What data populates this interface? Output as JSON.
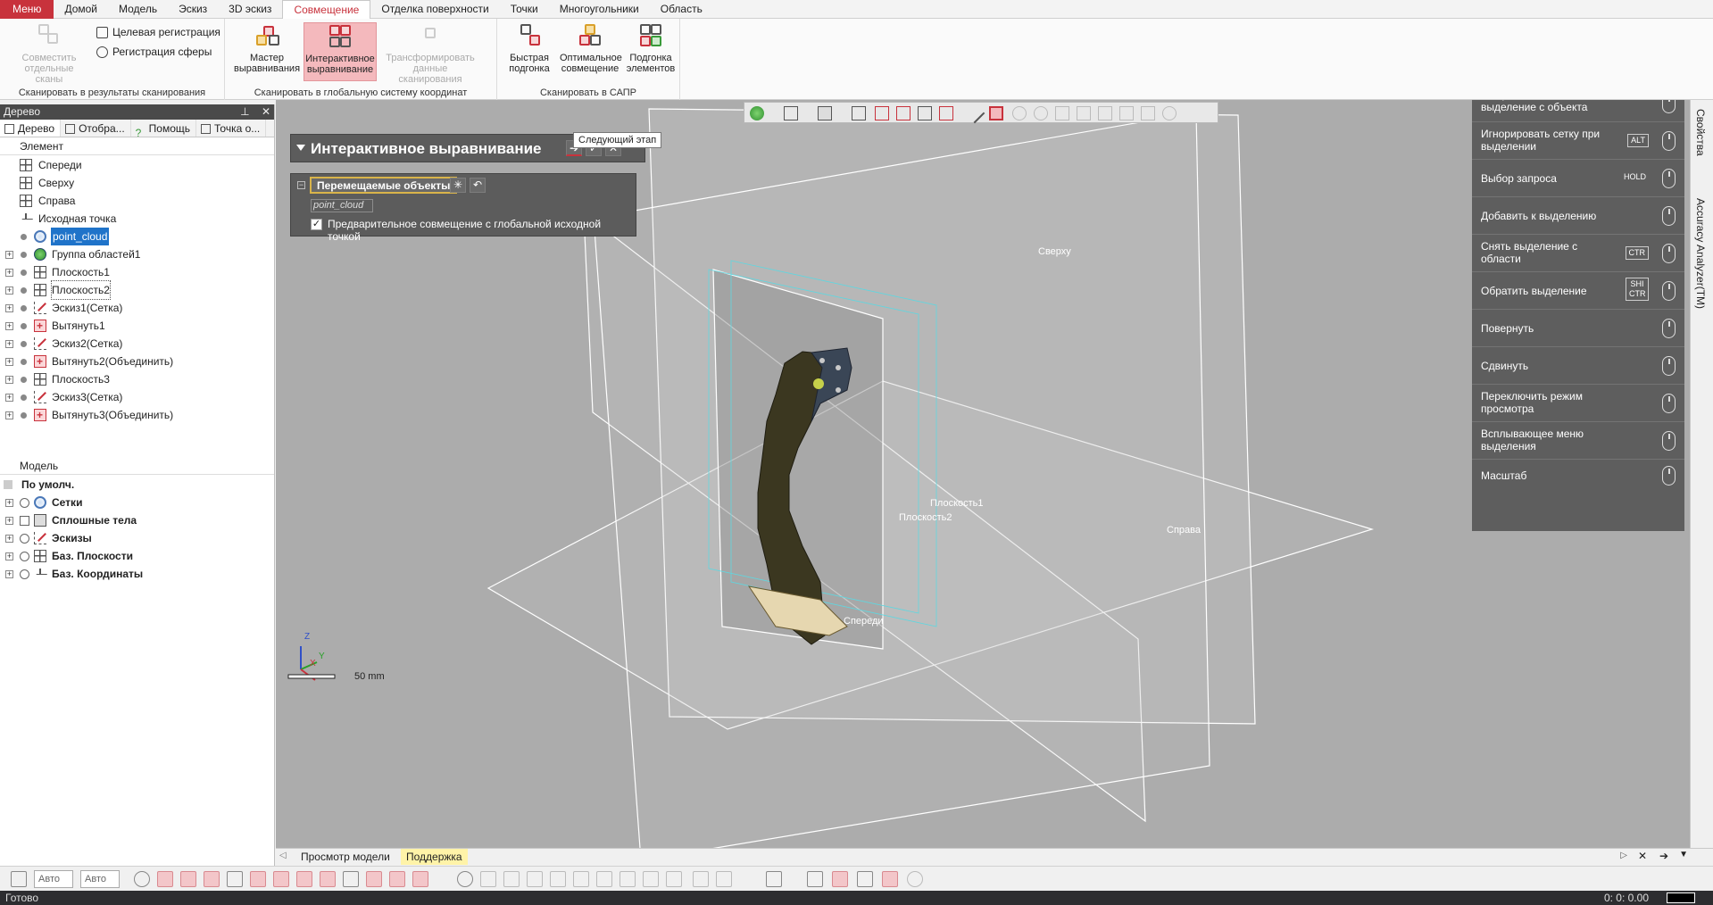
{
  "menubar": {
    "tabs": [
      "Меню",
      "Домой",
      "Модель",
      "Эскиз",
      "3D эскиз",
      "Совмещение",
      "Отделка поверхности",
      "Точки",
      "Многоугольники",
      "Область"
    ],
    "active": "Совмещение"
  },
  "ribbon": {
    "groups": [
      {
        "label": "Сканировать в результаты сканирования"
      },
      {
        "label": "Сканировать в глобальную систему координат"
      },
      {
        "label": "Сканировать в САПР"
      }
    ],
    "buttons": {
      "combine_scans": "Совместить отдельные сканы",
      "target_registration": "Целевая регистрация",
      "sphere_registration": "Регистрация сферы",
      "alignment_wizard": "Мастер выравнивания",
      "interactive_alignment": "Интерактивное выравнивание",
      "transform_scan": "Трансформировать данные сканирования",
      "quick_fit": "Быстрая подгонка",
      "best_fit": "Оптимальное совмещение",
      "feature_fit": "Подгонка элементов"
    }
  },
  "left_panel": {
    "title": "Дерево",
    "tabs": [
      "Дерево",
      "Отобра...",
      "Помощь",
      "Точка о..."
    ],
    "element_header": "Элемент",
    "tree": [
      {
        "label": "Спереди",
        "icon": "plane-icon",
        "level": 0
      },
      {
        "label": "Сверху",
        "icon": "plane-icon",
        "level": 0
      },
      {
        "label": "Справа",
        "icon": "plane-icon",
        "level": 0
      },
      {
        "label": "Исходная точка",
        "icon": "origin-icon",
        "level": 0
      },
      {
        "label": "point_cloud",
        "icon": "point-cloud-icon",
        "level": 1,
        "selected": true
      },
      {
        "label": "Группа областей1",
        "icon": "region-group-icon",
        "level": 1
      },
      {
        "label": "Плоскость1",
        "icon": "plane-icon",
        "level": 1
      },
      {
        "label": "Плоскость2",
        "icon": "plane-icon",
        "level": 1,
        "boxed": true
      },
      {
        "label": "Эскиз1(Сетка)",
        "icon": "sketch-icon",
        "level": 1
      },
      {
        "label": "Вытянуть1",
        "icon": "extrude-icon",
        "level": 1
      },
      {
        "label": "Эскиз2(Сетка)",
        "icon": "sketch-icon",
        "level": 1
      },
      {
        "label": "Вытянуть2(Объединить)",
        "icon": "extrude-icon",
        "level": 1
      },
      {
        "label": "Плоскость3",
        "icon": "plane-icon",
        "level": 1
      },
      {
        "label": "Эскиз3(Сетка)",
        "icon": "sketch-icon",
        "level": 1
      },
      {
        "label": "Вытянуть3(Объединить)",
        "icon": "extrude-icon",
        "level": 1
      }
    ],
    "model_header": "Модель",
    "model_tree": [
      {
        "label": "По умолч."
      },
      {
        "label": "Сетки"
      },
      {
        "label": "Сплошные тела"
      },
      {
        "label": "Эскизы"
      },
      {
        "label": "Баз. Плоскости"
      },
      {
        "label": "Баз. Координаты"
      }
    ]
  },
  "ia_panel": {
    "title": "Интерактивное выравнивание",
    "tooltip": "Следующий этап",
    "moving_objects": "Перемещаемые объекты",
    "object_name": "point_cloud",
    "checkbox_label": "Предварительное совмещение с глобальной исходной точкой",
    "checkbox_checked": true
  },
  "viewport": {
    "plane_labels": {
      "top": "Сверху",
      "right": "Справа",
      "front": "Спереди",
      "plane1": "Плоскость1",
      "plane2": "Плоскость2"
    },
    "scale_label": "50 mm",
    "axis_labels": {
      "z": "Z",
      "y": "Y",
      "x": "X"
    }
  },
  "mouse_help": [
    {
      "text": "Выбрать или снять выделение с объекта",
      "key": ""
    },
    {
      "text": "Игнорировать сетку при выделении",
      "key": "ALT"
    },
    {
      "text": "Выбор запроса",
      "key": "HOLD"
    },
    {
      "text": "Добавить к выделению",
      "key": ""
    },
    {
      "text": "Снять выделение с области",
      "key": "CTR"
    },
    {
      "text": "Обратить выделение",
      "key": "SHI CTR"
    },
    {
      "text": "Повернуть",
      "key": ""
    },
    {
      "text": "Сдвинуть",
      "key": ""
    },
    {
      "text": "Переключить режим просмотра",
      "key": ""
    },
    {
      "text": "Всплывающее меню выделения",
      "key": ""
    },
    {
      "text": "Масштаб",
      "key": ""
    }
  ],
  "right_tabs": [
    "Свойства",
    "Accuracy Analyzer(TM)"
  ],
  "bottom_tabs": [
    "Просмотр модели",
    "Поддержка"
  ],
  "bottom_toolbar": {
    "combo1": "Авто",
    "combo2": "Авто"
  },
  "status": {
    "text": "Готово",
    "coords": "0: 0: 0.00"
  },
  "colors": {
    "accent": "#c8323c",
    "panel": "#5c5c5c",
    "viewport": "#acacac"
  }
}
